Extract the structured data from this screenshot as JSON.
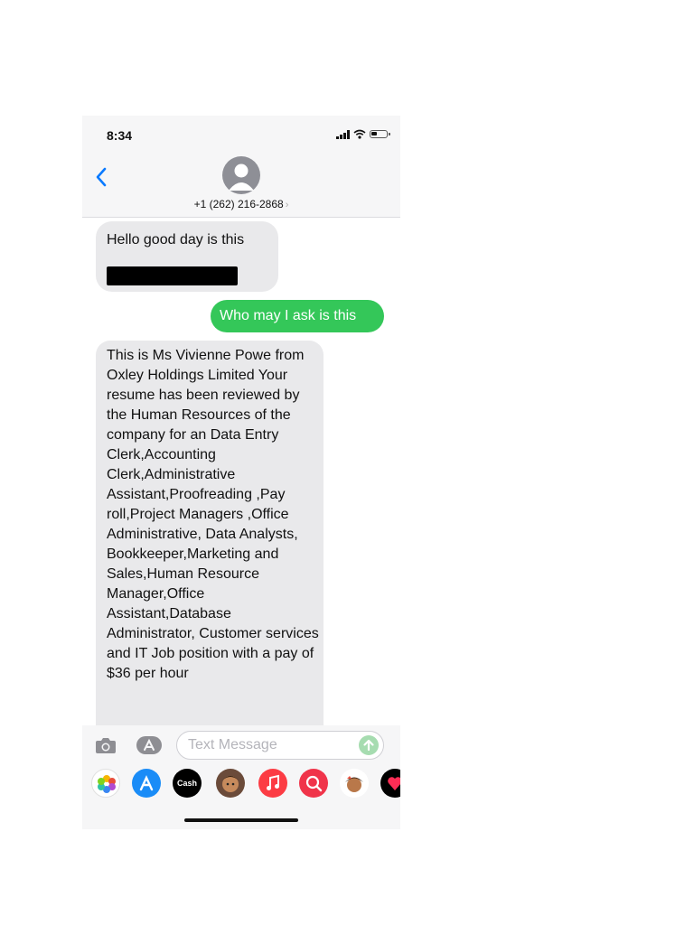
{
  "status_bar": {
    "time": "8:34"
  },
  "header": {
    "contact": "+1 (262) 216-2868",
    "contact_chevron": "›"
  },
  "messages": [
    {
      "direction": "incoming",
      "text": "Hello good day is this",
      "redacted_line": true
    },
    {
      "direction": "outgoing",
      "text": "Who may I ask is this"
    },
    {
      "direction": "incoming",
      "text": "This  is Ms  Vivienne Powe from    Oxley Holdings Limited  Your resume has been reviewed by the Human Resources of the company for an Data Entry Clerk,Accounting Clerk,Administrative Assistant,Proofreading ,Pay roll,Project Managers ,Office Administrative, Data Analysts, Bookkeeper,Marketing and Sales,Human Resource Manager,Office Assistant,Database Administrator, Customer services and IT Job position with a pay of $36 per hour"
    }
  ],
  "input": {
    "placeholder": "Text Message"
  },
  "app_drawer": {
    "apps": [
      "photos-icon",
      "app-store-icon",
      "apple-cash-icon",
      "memoji-icon",
      "music-icon",
      "search-images-icon",
      "memoji-stickers-icon",
      "digital-touch-icon"
    ],
    "cash_label": "Cash"
  },
  "colors": {
    "outgoing_bubble": "#34c759",
    "incoming_bubble": "#e9e9eb",
    "accent": "#0a7aff"
  }
}
